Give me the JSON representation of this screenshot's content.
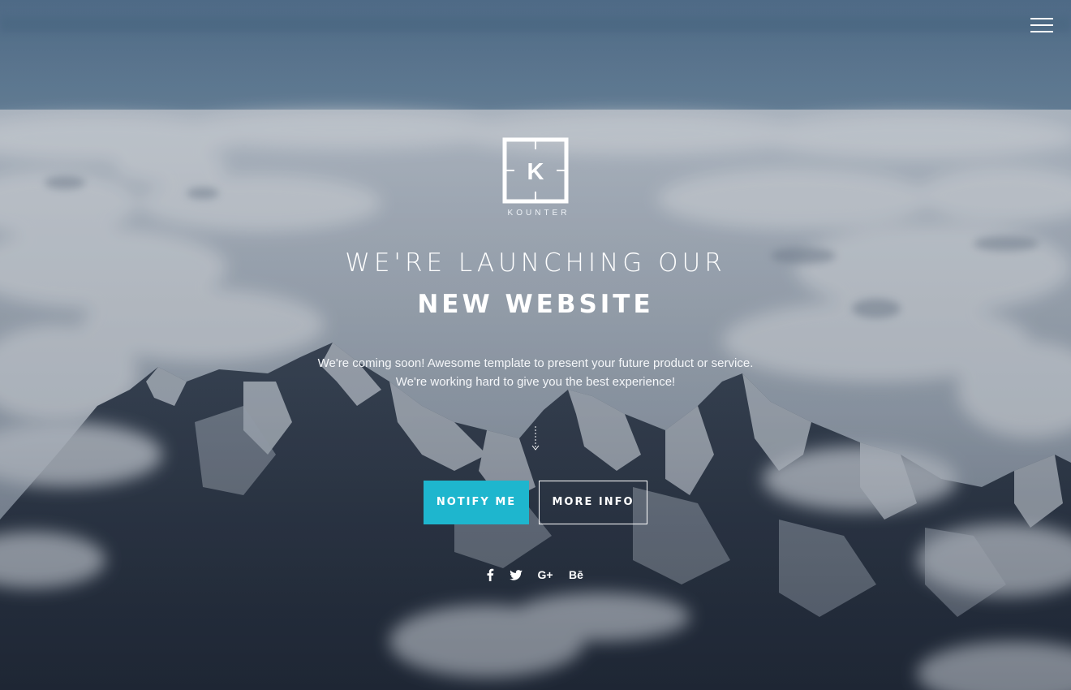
{
  "brand": {
    "logo_letter": "K",
    "name": "KOUNTER"
  },
  "hero": {
    "headline_light": "WE'RE LAUNCHING OUR",
    "headline_bold": "NEW WEBSITE",
    "description_line1": "We're coming soon! Awesome template to present your future product or service.",
    "description_line2": "We're working hard to give you the best experience!"
  },
  "buttons": {
    "notify_label": "NOTIFY ME",
    "more_info_label": "MORE INFO"
  },
  "social": [
    {
      "icon": "facebook-icon"
    },
    {
      "icon": "twitter-icon"
    },
    {
      "icon": "google-plus-icon",
      "label": "G+"
    },
    {
      "icon": "behance-icon",
      "label": "Bē"
    }
  ],
  "colors": {
    "accent": "#1eb6ce",
    "text": "#ffffff"
  },
  "icons": {
    "menu": "hamburger-menu-icon",
    "scroll": "scroll-down-arrow-icon"
  }
}
